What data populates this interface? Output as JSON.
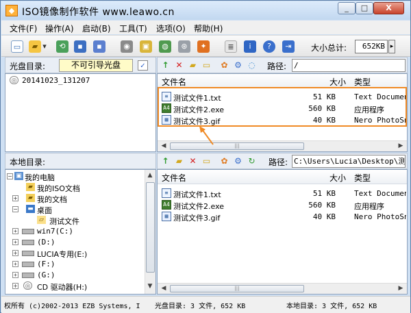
{
  "window": {
    "title": "ISO镜像制作软件 www.leawo.cn",
    "min_label": "_",
    "max_label": "□",
    "close_label": "X"
  },
  "menu": [
    "文件(F)",
    "操作(A)",
    "启动(B)",
    "工具(T)",
    "选项(O)",
    "帮助(H)"
  ],
  "toolbar": {
    "size_label": "大小总计:",
    "size_value": "652KB",
    "size_drop": "▸"
  },
  "disc_bar": {
    "label": "光盘目录:",
    "boot_field": "不可引导光盘",
    "path_label": "路径:",
    "path_value": "/"
  },
  "disc_tree": [
    {
      "label": "20141023_131207"
    }
  ],
  "disc_files": {
    "headers": {
      "name": "文件名",
      "size": "大小",
      "type": "类型"
    },
    "rows": [
      {
        "name": "测试文件1.txt",
        "size": "51 KB",
        "type": "Text Document",
        "icon": "txt-file-icon"
      },
      {
        "name": "测试文件2.exe",
        "size": "560 KB",
        "type": "应用程序",
        "icon": "exe-file-icon"
      },
      {
        "name": "测试文件3.gif",
        "size": "40 KB",
        "type": "Nero PhotoSnap",
        "icon": "gif-file-icon"
      }
    ]
  },
  "local_bar": {
    "label": "本地目录:",
    "path_label": "路径:",
    "path_value": "C:\\Users\\Lucia\\Desktop\\测试文"
  },
  "local_tree": [
    {
      "label": "我的电脑"
    },
    {
      "label": "我的ISO文档"
    },
    {
      "label": "我的文档"
    },
    {
      "label": "桌面"
    },
    {
      "label": "测试文件"
    },
    {
      "label": "win7(C:)"
    },
    {
      "label": "(D:)"
    },
    {
      "label": "LUCIA专用(E:)"
    },
    {
      "label": "(F:)"
    },
    {
      "label": "(G:)"
    },
    {
      "label": "CD 驱动器(H:)"
    }
  ],
  "local_files": {
    "headers": {
      "name": "文件名",
      "size": "大小",
      "type": "类型"
    },
    "rows": [
      {
        "name": "测试文件1.txt",
        "size": "51 KB",
        "type": "Text Document",
        "icon": "txt-file-icon"
      },
      {
        "name": "测试文件2.exe",
        "size": "560 KB",
        "type": "应用程序",
        "icon": "exe-file-icon"
      },
      {
        "name": "测试文件3.gif",
        "size": "40 KB",
        "type": "Nero PhotoSnap",
        "icon": "gif-file-icon"
      }
    ]
  },
  "status": {
    "copyright": "权所有 (c)2002-2013 EZB Systems, I",
    "disc_summary": "光盘目录: 3 文件, 652 KB",
    "local_summary": "本地目录: 3 文件, 652 KB"
  },
  "colors": {
    "highlight": "#f08a24"
  }
}
